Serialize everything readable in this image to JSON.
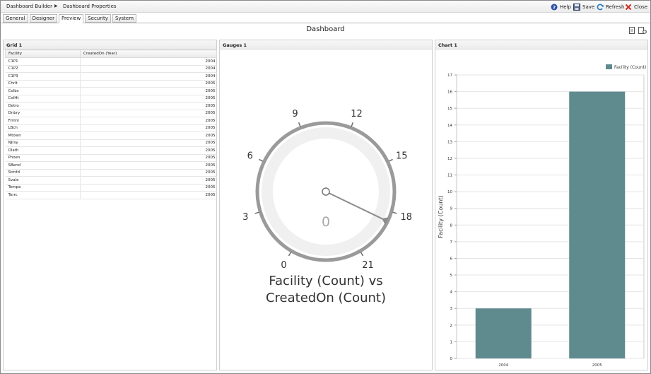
{
  "breadcrumb": {
    "first": "Dashboard Builder",
    "second": "Dashboard Properties"
  },
  "toolbar": {
    "help": "Help",
    "save": "Save",
    "refresh": "Refresh",
    "close": "Close"
  },
  "tabs": [
    "General",
    "Designer",
    "Preview",
    "Security",
    "System"
  ],
  "active_tab": "Preview",
  "dashboard": {
    "title": "Dashboard"
  },
  "grid": {
    "title": "Grid 1",
    "columns": [
      "Facility",
      "CreatedOn (Year)"
    ],
    "rows": [
      [
        "C1P1",
        "2004"
      ],
      [
        "C1P2",
        "2004"
      ],
      [
        "C1P3",
        "2004"
      ],
      [
        "Chrlt",
        "2005"
      ],
      [
        "Colbs",
        "2005"
      ],
      [
        "ColHt",
        "2005"
      ],
      [
        "Detro",
        "2005"
      ],
      [
        "Dnbry",
        "2005"
      ],
      [
        "Frmhl",
        "2005"
      ],
      [
        "LBch",
        "2005"
      ],
      [
        "Mtown",
        "2005"
      ],
      [
        "NJrsy",
        "2005"
      ],
      [
        "Olath",
        "2005"
      ],
      [
        "Phoen",
        "2005"
      ],
      [
        "SBend",
        "2005"
      ],
      [
        "Stmfd",
        "2005"
      ],
      [
        "Svale",
        "2005"
      ],
      [
        "Tempe",
        "2005"
      ],
      [
        "Torrc",
        "2005"
      ]
    ]
  },
  "gauge": {
    "title": "Gauges 1",
    "ticks": [
      "0",
      "3",
      "6",
      "9",
      "12",
      "15",
      "18",
      "21"
    ],
    "value": "0",
    "pointer_value": 18.6,
    "caption_line1": "Facility (Count) vs",
    "caption_line2": "CreatedOn (Count)"
  },
  "chart_panel": {
    "title": "Chart 1"
  },
  "chart_data": {
    "type": "bar",
    "categories": [
      "2004",
      "2005"
    ],
    "series": [
      {
        "name": "Facility (Count)",
        "values": [
          3,
          16
        ]
      }
    ],
    "xlabel": "",
    "ylabel": "Facility (Count)",
    "ylim": [
      0,
      17
    ],
    "yticks": [
      "0",
      "1",
      "2",
      "3",
      "4",
      "5",
      "6",
      "7",
      "8",
      "9",
      "10",
      "11",
      "12",
      "13",
      "14",
      "15",
      "16",
      "17"
    ],
    "legend": "top-right",
    "grid": true,
    "bar_color": "#5f8a8e"
  },
  "colors": {
    "bar": "#5f8a8e",
    "gauge_ring": "#9a9a9a",
    "gauge_inner": "#f0f0f0",
    "needle": "#8c8c8c"
  }
}
